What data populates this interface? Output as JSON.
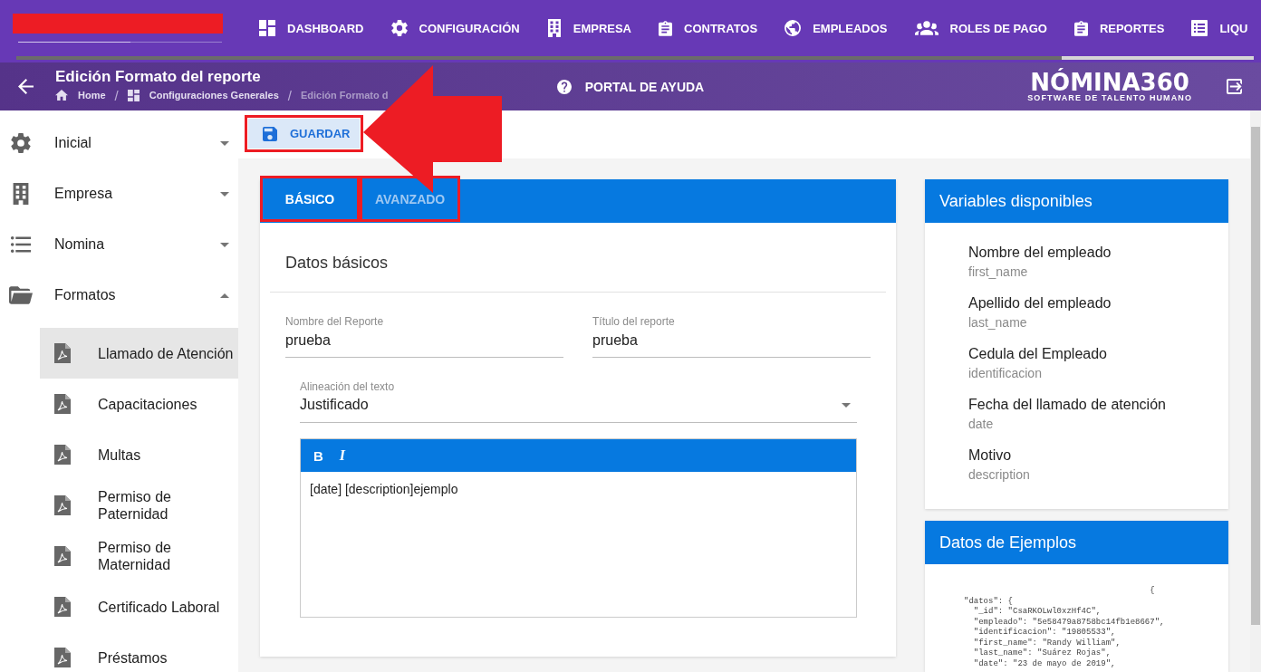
{
  "top_nav": {
    "items": [
      {
        "label": "DASHBOARD"
      },
      {
        "label": "CONFIGURACIÓN"
      },
      {
        "label": "EMPRESA"
      },
      {
        "label": "CONTRATOS"
      },
      {
        "label": "EMPLEADOS"
      },
      {
        "label": "ROLES DE PAGO"
      },
      {
        "label": "REPORTES"
      },
      {
        "label": "LIQU"
      }
    ]
  },
  "header": {
    "title": "Edición Formato del reporte",
    "breadcrumb": [
      {
        "label": "Home",
        "current": false
      },
      {
        "separator": "/",
        "label": "Configuraciones Generales",
        "current": false
      },
      {
        "separator": "/",
        "label": "Edición Formato d",
        "current": true
      }
    ],
    "help_link": "PORTAL DE AYUDA",
    "logo": {
      "name": "NÓMINA360",
      "tagline": "SOFTWARE DE TALENTO HUMANO"
    }
  },
  "sidebar": {
    "items": [
      {
        "label": "Inicial",
        "expanded": false,
        "selected": false
      },
      {
        "label": "Empresa",
        "expanded": false,
        "selected": false
      },
      {
        "label": "Nomina",
        "expanded": false,
        "selected": false
      },
      {
        "label": "Formatos",
        "expanded": true,
        "selected": false,
        "children": [
          {
            "label": "Llamado de Atención",
            "selected": true
          },
          {
            "label": "Capacitaciones",
            "selected": false
          },
          {
            "label": "Multas",
            "selected": false
          },
          {
            "label": "Permiso de Paternidad",
            "selected": false
          },
          {
            "label": "Permiso de Maternidad",
            "selected": false
          },
          {
            "label": "Certificado Laboral",
            "selected": false
          },
          {
            "label": "Préstamos",
            "selected": false
          }
        ]
      }
    ]
  },
  "toolbar": {
    "save_button": "GUARDAR"
  },
  "form_card": {
    "tabs": [
      {
        "label": "BÁSICO",
        "selected": true
      },
      {
        "label": "AVANZADO",
        "selected": false
      }
    ],
    "section_title": "Datos básicos",
    "fields": [
      {
        "label": "Nombre del Reporte",
        "value": "prueba"
      },
      {
        "label": "Título del reporte",
        "value": "prueba"
      }
    ],
    "alignment_select": {
      "label": "Alineación del texto",
      "value": "Justificado"
    },
    "editor": {
      "toolbar": [
        {
          "label": "B",
          "kind": "bold"
        },
        {
          "label": "I",
          "kind": "italic"
        }
      ],
      "content": "[date] [description]ejemplo"
    }
  },
  "variables_card": {
    "title": "Variables disponibles",
    "items": [
      {
        "name": "Nombre del empleado",
        "code": "first_name"
      },
      {
        "name": "Apellido del empleado",
        "code": "last_name"
      },
      {
        "name": "Cedula del Empleado",
        "code": "identificacion"
      },
      {
        "name": "Fecha del llamado de atención",
        "code": "date"
      },
      {
        "name": "Motivo",
        "code": "description"
      }
    ]
  },
  "examples_card": {
    "title": "Datos de Ejemplos",
    "code": "                                      {\n\"datos\": {\n  \"_id\": \"CsaRKOLwl0xzHf4C\",\n  \"empleado\": \"5e58479a8758bc14fb1e8667\",\n  \"identificacion\": \"19805533\",\n  \"first_name\": \"Randy William\",\n  \"last_name\": \"Suárez Rojas\",\n  \"date\": \"23 de mayo de 2019\","
  }
}
